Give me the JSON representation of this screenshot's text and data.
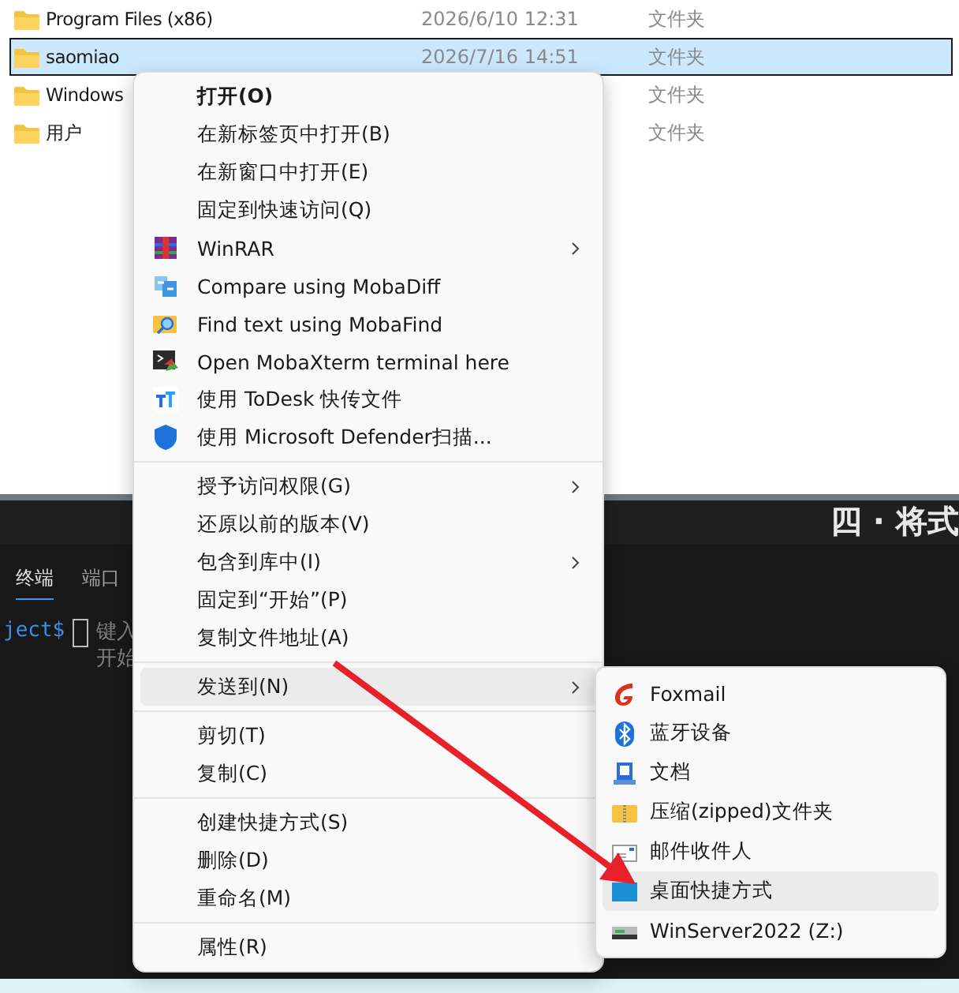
{
  "file_list": {
    "rows": [
      {
        "name": "Program Files (x86)",
        "date": "2026/6/10 12:31",
        "type": "文件夹",
        "selected": false
      },
      {
        "name": "saomiao",
        "date": "2026/7/16 14:51",
        "type": "文件夹",
        "selected": true
      },
      {
        "name": "Windows",
        "type": "文件夹",
        "selected": false
      },
      {
        "name": "用户",
        "type": "文件夹",
        "selected": false
      }
    ]
  },
  "terminal": {
    "heading": "四 · 将式",
    "tabs": [
      {
        "label": "终端",
        "selected": true
      },
      {
        "label": "端口",
        "selected": false
      }
    ],
    "prompt": "ject$",
    "hint_lines": [
      "键入",
      "开始"
    ]
  },
  "context_menu": {
    "groups": [
      [
        {
          "label": "打开(O)",
          "default": true,
          "submenu": false,
          "selected": false
        },
        {
          "label": "在新标签页中打开(B)",
          "default": false,
          "submenu": false,
          "selected": false
        },
        {
          "label": "在新窗口中打开(E)",
          "default": false,
          "submenu": false,
          "selected": false
        },
        {
          "label": "固定到快速访问(Q)",
          "default": false,
          "submenu": false,
          "selected": false
        },
        {
          "label": "WinRAR",
          "default": false,
          "submenu": true,
          "selected": false
        },
        {
          "label": "Compare using MobaDiff",
          "default": false,
          "submenu": false,
          "selected": false
        },
        {
          "label": "Find text using MobaFind",
          "default": false,
          "submenu": false,
          "selected": false
        },
        {
          "label": "Open MobaXterm terminal here",
          "default": false,
          "submenu": false,
          "selected": false
        },
        {
          "label": "使用 ToDesk 快传文件",
          "default": false,
          "submenu": false,
          "selected": false
        },
        {
          "label": "使用 Microsoft Defender扫描...",
          "default": false,
          "submenu": false,
          "selected": false
        }
      ],
      [
        {
          "label": "授予访问权限(G)",
          "default": false,
          "submenu": true,
          "selected": false
        },
        {
          "label": "还原以前的版本(V)",
          "default": false,
          "submenu": false,
          "selected": false
        },
        {
          "label": "包含到库中(I)",
          "default": false,
          "submenu": true,
          "selected": false
        },
        {
          "label": "固定到“开始”(P)",
          "default": false,
          "submenu": false,
          "selected": false
        },
        {
          "label": "复制文件地址(A)",
          "default": false,
          "submenu": false,
          "selected": false
        }
      ],
      [
        {
          "label": "发送到(N)",
          "default": false,
          "submenu": true,
          "selected": true
        }
      ],
      [
        {
          "label": "剪切(T)",
          "default": false,
          "submenu": false,
          "selected": false
        },
        {
          "label": "复制(C)",
          "default": false,
          "submenu": false,
          "selected": false
        }
      ],
      [
        {
          "label": "创建快捷方式(S)",
          "default": false,
          "submenu": false,
          "selected": false
        },
        {
          "label": "删除(D)",
          "default": false,
          "submenu": false,
          "selected": false
        },
        {
          "label": "重命名(M)",
          "default": false,
          "submenu": false,
          "selected": false
        }
      ],
      [
        {
          "label": "属性(R)",
          "default": false,
          "submenu": false,
          "selected": false
        }
      ]
    ]
  },
  "send_to_menu": {
    "items": [
      {
        "label": "Foxmail",
        "selected": false
      },
      {
        "label": "蓝牙设备",
        "selected": false
      },
      {
        "label": "文档",
        "selected": false
      },
      {
        "label": "压缩(zipped)文件夹",
        "selected": false
      },
      {
        "label": "邮件收件人",
        "selected": false
      },
      {
        "label": "桌面快捷方式",
        "selected": true
      },
      {
        "label": "WinServer2022 (Z:)",
        "selected": false
      }
    ]
  }
}
